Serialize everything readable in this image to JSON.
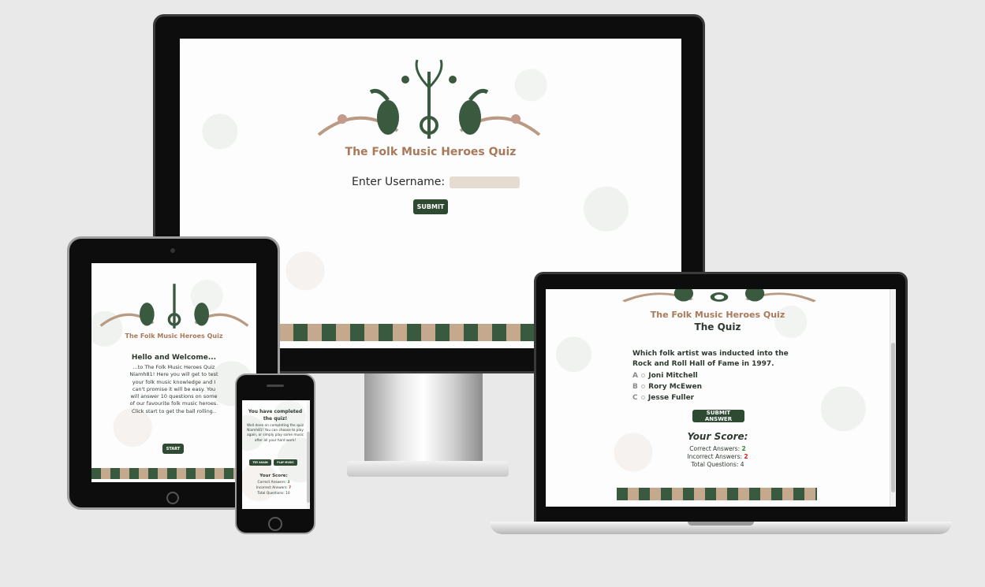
{
  "colors": {
    "accent_green": "#2e4a32",
    "title_brown": "#a9795a",
    "input_bg": "#e6dbd0",
    "correct": "#2e8b2e",
    "incorrect": "#d62020"
  },
  "desktop": {
    "title": "The Folk Music Heroes Quiz",
    "username_label": "Enter Username:",
    "username_value": "",
    "submit_label": "SUBMIT"
  },
  "tablet": {
    "title": "The Folk Music Heroes Quiz",
    "heading": "Hello and Welcome...",
    "body": "...to The Folk Music Heroes Quiz Niamh81! Here you will get to test your folk music knowledge and I can't promise it will be easy. You will answer 10 questions on some of our favourite folk music heroes. Click start to get the ball rolling..",
    "start_label": "START"
  },
  "laptop": {
    "title": "The Folk Music Heroes Quiz",
    "subtitle": "The Quiz",
    "question": "Which folk artist was inducted into the Rock and Roll Hall of Fame in 1997.",
    "options": [
      {
        "letter": "A",
        "text": "Joni Mitchell"
      },
      {
        "letter": "B",
        "text": "Rory McEwen"
      },
      {
        "letter": "C",
        "text": "Jesse Fuller"
      }
    ],
    "submit_answer_label": "SUBMIT ANSWER",
    "score_heading": "Your Score:",
    "correct_label": "Correct Answers:",
    "correct_value": "2",
    "incorrect_label": "Incorrect Answers:",
    "incorrect_value": "2",
    "total_label": "Total Questions:",
    "total_value": "4"
  },
  "phone": {
    "heading": "You have completed the quiz!",
    "body": "Well done on completing the quiz Niamh81! You can choose to play again, or simply play some music after all your hard work!",
    "try_again_label": "TRY AGAIN",
    "play_music_label": "PLAY MUSIC",
    "score_heading": "Your Score:",
    "correct_label": "Correct Answers:",
    "correct_value": "3",
    "incorrect_label": "Incorrect Answers:",
    "incorrect_value": "7",
    "total_label": "Total Questions:",
    "total_value": "10"
  }
}
